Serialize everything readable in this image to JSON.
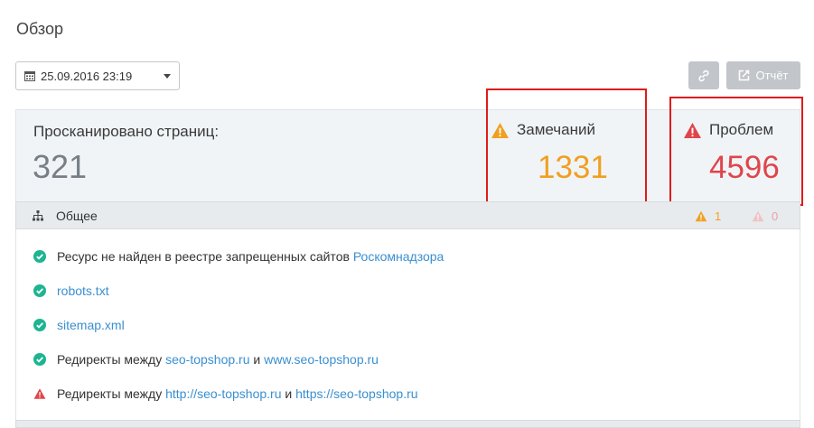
{
  "page": {
    "title": "Обзор"
  },
  "toolbar": {
    "date_value": "25.09.2016 23:19",
    "report_label": "Отчёт"
  },
  "summary": {
    "scanned_label": "Просканировано страниц:",
    "scanned_value": "321",
    "warnings_label": "Замечаний",
    "warnings_value": "1331",
    "problems_label": "Проблем",
    "problems_value": "4596"
  },
  "section": {
    "title": "Общее",
    "warnings_count": "1",
    "problems_count": "0"
  },
  "checks": [
    {
      "status": "ok",
      "text": "Ресурс не найден в реестре запрещенных сайтов ",
      "link": "Роскомнадзора"
    },
    {
      "status": "ok",
      "link": "robots.txt"
    },
    {
      "status": "ok",
      "link": "sitemap.xml"
    },
    {
      "status": "ok",
      "text": "Редиректы между ",
      "link": "seo-topshop.ru",
      "mid": " и ",
      "link2": "www.seo-topshop.ru"
    },
    {
      "status": "warning",
      "text": "Редиректы между ",
      "link": "http://seo-topshop.ru",
      "mid": " и ",
      "link2": "https://seo-topshop.ru"
    }
  ],
  "colors": {
    "warning": "#f0a020",
    "problem": "#e0454a",
    "ok": "#1cb590",
    "link": "#3a8fd0",
    "highlight": "#e01b1b"
  }
}
